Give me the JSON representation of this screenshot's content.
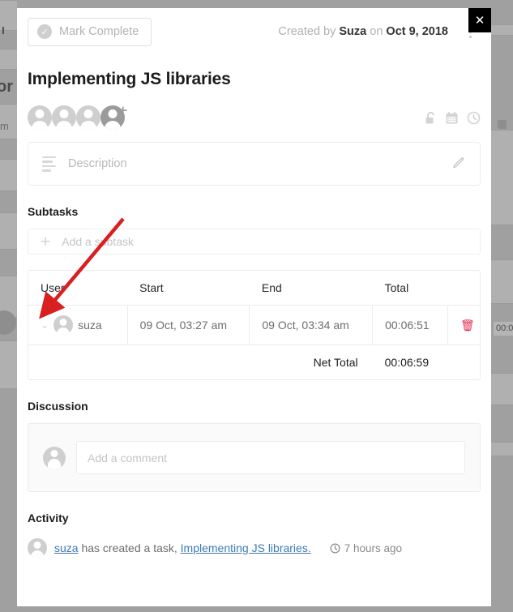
{
  "window": {
    "close_label": "✕"
  },
  "header": {
    "mark_complete_label": "Mark Complete",
    "check_icon": "check-circle-icon",
    "created_prefix": "Created by ",
    "created_author": "Suza",
    "created_mid": " on ",
    "created_date": "Oct 9, 2018",
    "kebab_icon": "more-vertical-icon"
  },
  "task": {
    "title": "Implementing JS libraries",
    "assignees_count": 3,
    "add_assignee_icon": "add-person-icon",
    "icons": [
      "unlock-icon",
      "calendar-icon",
      "clock-icon"
    ]
  },
  "description": {
    "placeholder": "Description",
    "lines_icon": "text-lines-icon",
    "edit_icon": "pencil-icon"
  },
  "subtasks": {
    "heading": "Subtasks",
    "add_label": "Add a subtask",
    "add_icon": "plus-icon",
    "table": {
      "columns": [
        "User",
        "Start",
        "End",
        "Total"
      ],
      "rows": [
        {
          "expand_icon": "chevron-down-icon",
          "avatar": "user-avatar",
          "user": "suza",
          "start": "09 Oct, 03:27 am",
          "end": "09 Oct, 03:34 am",
          "total": "00:06:51",
          "delete_icon": "trash-icon"
        }
      ],
      "net_total_label": "Net Total",
      "net_total_value": "00:06:59"
    }
  },
  "discussion": {
    "heading": "Discussion",
    "avatar": "user-avatar",
    "comment_placeholder": "Add a comment"
  },
  "activity": {
    "heading": "Activity",
    "avatar": "user-avatar",
    "entry_user": "suza",
    "entry_text": " has created a task, ",
    "entry_link": "Implementing JS libraries.",
    "time_icon": "clock-icon",
    "entry_time": "7 hours ago"
  },
  "background": {
    "fragments": [
      "• I",
      "or",
      "m",
      "00:0"
    ]
  },
  "colors": {
    "accent_link": "#3d7ab5",
    "danger": "#e02b4b",
    "annotation": "#d82020",
    "text_primary": "#1c1c1c",
    "text_muted": "#6d6d6d",
    "border": "#ececec"
  }
}
